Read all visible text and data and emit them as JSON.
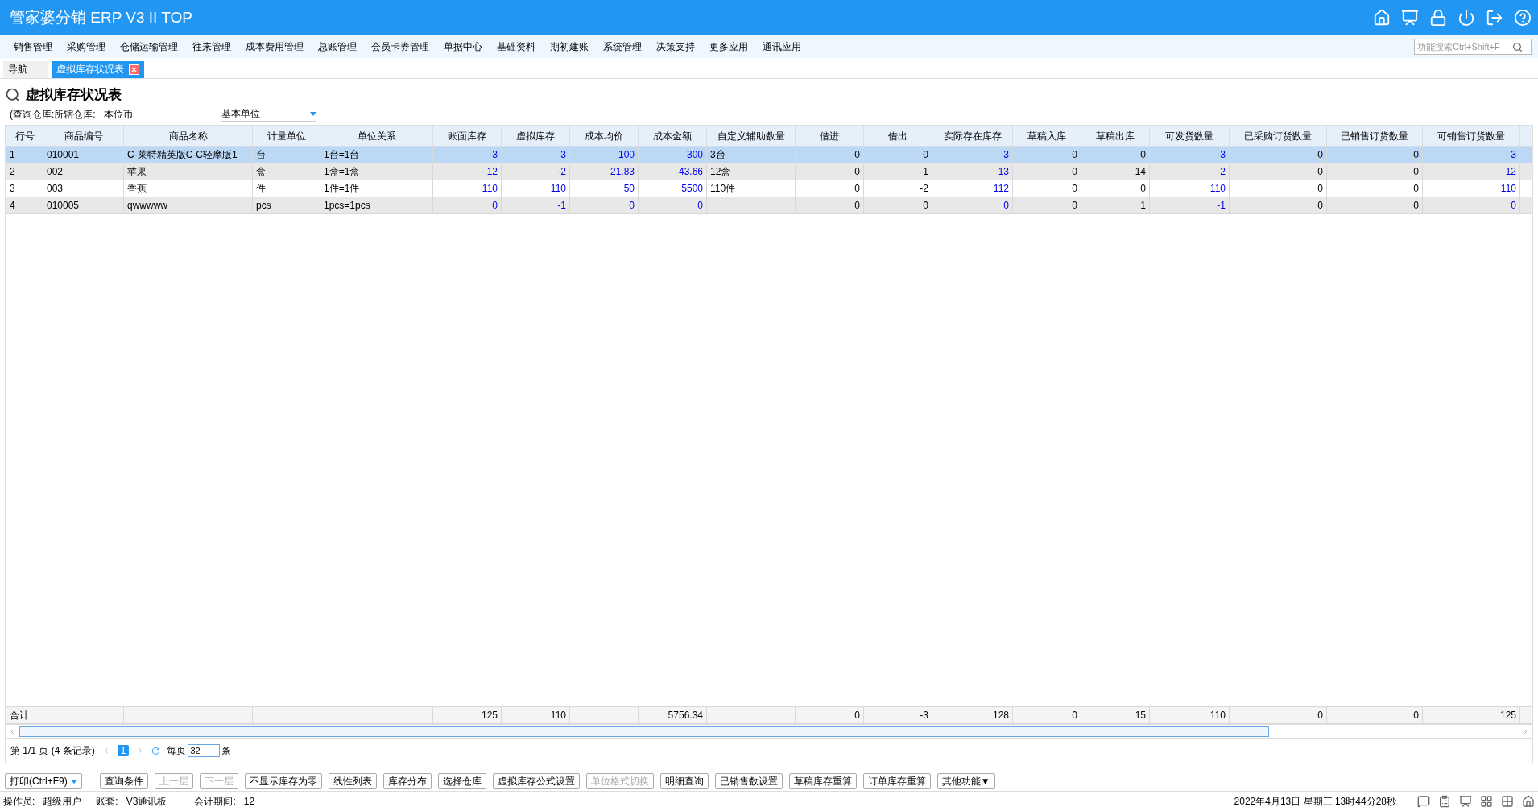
{
  "window": {
    "title": "管家婆分销 ERP V3 II TOP"
  },
  "menu": [
    {
      "label": "销售管理"
    },
    {
      "label": "采购管理"
    },
    {
      "label": "仓储运输管理"
    },
    {
      "label": "往来管理"
    },
    {
      "label": "成本费用管理"
    },
    {
      "label": "总账管理"
    },
    {
      "label": "会员卡券管理"
    },
    {
      "label": "单据中心"
    },
    {
      "label": "基础资料"
    },
    {
      "label": "期初建账"
    },
    {
      "label": "系统管理"
    },
    {
      "label": "决策支持"
    },
    {
      "label": "更多应用"
    },
    {
      "label": "通讯应用"
    }
  ],
  "search": {
    "placeholder": "功能搜索Ctrl+Shift+F"
  },
  "tabs": [
    {
      "label": "导航",
      "selected": false,
      "closable": false
    },
    {
      "label": "虚拟库存状况表",
      "selected": true,
      "closable": true
    }
  ],
  "report": {
    "title": "虚拟库存状况表",
    "filter_label": "(查询仓库:所辖仓库:",
    "currency": "本位币",
    "unit_select": "基本单位"
  },
  "table": {
    "columns": [
      {
        "label": "行号",
        "kind": "text"
      },
      {
        "label": "商品编号",
        "kind": "text"
      },
      {
        "label": "商品名称",
        "kind": "text"
      },
      {
        "label": "计量单位",
        "kind": "text"
      },
      {
        "label": "单位关系",
        "kind": "text"
      },
      {
        "label": "账面库存",
        "kind": "link"
      },
      {
        "label": "虚拟库存",
        "kind": "link"
      },
      {
        "label": "成本均价",
        "kind": "link"
      },
      {
        "label": "成本金额",
        "kind": "link"
      },
      {
        "label": "自定义辅助数量",
        "kind": "text"
      },
      {
        "label": "借进",
        "kind": "number"
      },
      {
        "label": "借出",
        "kind": "number"
      },
      {
        "label": "实际存在库存",
        "kind": "link"
      },
      {
        "label": "草稿入库",
        "kind": "number"
      },
      {
        "label": "草稿出库",
        "kind": "number"
      },
      {
        "label": "可发货数量",
        "kind": "link"
      },
      {
        "label": "已采购订货数量",
        "kind": "number"
      },
      {
        "label": "已销售订货数量",
        "kind": "number"
      },
      {
        "label": "可销售订货数量",
        "kind": "link"
      }
    ],
    "rows": [
      {
        "selected": true,
        "cells": [
          "1",
          "010001",
          "C-莱特精英版C-C轻摩版1",
          "台",
          "1台=1台",
          "3",
          "3",
          "100",
          "300",
          "3台",
          "0",
          "0",
          "3",
          "0",
          "0",
          "3",
          "0",
          "0",
          "3"
        ]
      },
      {
        "selected": false,
        "cells": [
          "2",
          "002",
          "苹果",
          "盒",
          "1盒=1盒",
          "12",
          "-2",
          "21.83",
          "-43.66",
          "12盒",
          "0",
          "-1",
          "13",
          "0",
          "14",
          "-2",
          "0",
          "0",
          "12"
        ]
      },
      {
        "selected": false,
        "cells": [
          "3",
          "003",
          "香蕉",
          "件",
          "1件=1件",
          "110",
          "110",
          "50",
          "5500",
          "110件",
          "0",
          "-2",
          "112",
          "0",
          "0",
          "110",
          "0",
          "0",
          "110"
        ]
      },
      {
        "selected": false,
        "cells": [
          "4",
          "010005",
          "qwwwww",
          "pcs",
          "1pcs=1pcs",
          "0",
          "-1",
          "0",
          "0",
          null,
          "0",
          "0",
          "0",
          "0",
          "1",
          "-1",
          "0",
          "0",
          "0"
        ]
      }
    ],
    "totals": [
      {
        "kind": "label",
        "text": "合计"
      },
      {
        "kind": "blank"
      },
      {
        "kind": "blank"
      },
      {
        "kind": "blank"
      },
      {
        "kind": "blank"
      },
      {
        "kind": "value",
        "text": "125"
      },
      {
        "kind": "value",
        "text": "110"
      },
      {
        "kind": "blank"
      },
      {
        "kind": "value",
        "text": "5756.34"
      },
      {
        "kind": "blank"
      },
      {
        "kind": "value",
        "text": "0"
      },
      {
        "kind": "value",
        "text": "-3"
      },
      {
        "kind": "value",
        "text": "128"
      },
      {
        "kind": "value",
        "text": "0"
      },
      {
        "kind": "value",
        "text": "15"
      },
      {
        "kind": "value",
        "text": "110"
      },
      {
        "kind": "value",
        "text": "0"
      },
      {
        "kind": "value",
        "text": "0"
      },
      {
        "kind": "value",
        "text": "125"
      }
    ]
  },
  "pager": {
    "info": "第  1/1 页  (4 条记录)",
    "page": "1",
    "per_page_label": "每页",
    "per_page": "32",
    "unit": "条"
  },
  "buttons": [
    {
      "label": "打印(Ctrl+F9)",
      "kind": "dropdown",
      "disabled": false
    },
    {
      "label": "查询条件",
      "kind": "plain",
      "disabled": false
    },
    {
      "label": "上一层",
      "kind": "plain",
      "disabled": true
    },
    {
      "label": "下一层",
      "kind": "plain",
      "disabled": true
    },
    {
      "label": "不显示库存为零",
      "kind": "plain",
      "disabled": false
    },
    {
      "label": "线性列表",
      "kind": "plain",
      "disabled": false
    },
    {
      "label": "库存分布",
      "kind": "plain",
      "disabled": false
    },
    {
      "label": "选择仓库",
      "kind": "plain",
      "disabled": false
    },
    {
      "label": "虚拟库存公式设置",
      "kind": "plain",
      "disabled": false
    },
    {
      "label": "单位格式切换",
      "kind": "plain",
      "disabled": true
    },
    {
      "label": "明细查询",
      "kind": "plain",
      "disabled": false
    },
    {
      "label": "已销售数设置",
      "kind": "plain",
      "disabled": false
    },
    {
      "label": "草稿库存重算",
      "kind": "plain",
      "disabled": false
    },
    {
      "label": "订单库存重算",
      "kind": "plain",
      "disabled": false
    },
    {
      "label": "其他功能▼",
      "kind": "plain",
      "disabled": false
    }
  ],
  "status_bar": {
    "operator_label": "操作员:",
    "operator": "超级用户",
    "account_label": "账套:",
    "account": "V3通讯板",
    "period_label": "会计期间:",
    "period": "12",
    "datetime": "2022年4月13日  星期三  13时44分28秒"
  }
}
